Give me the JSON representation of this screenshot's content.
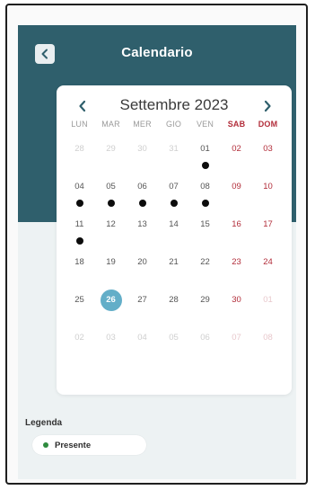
{
  "header": {
    "title": "Calendario",
    "background_color": "#2f5f6c",
    "back_icon": "chevron-left-icon"
  },
  "calendar": {
    "month_label": "Settembre 2023",
    "prev_icon": "chevron-left-icon",
    "next_icon": "chevron-right-icon",
    "weekdays": [
      {
        "label": "LUN",
        "weekend": false
      },
      {
        "label": "MAR",
        "weekend": false
      },
      {
        "label": "MER",
        "weekend": false
      },
      {
        "label": "GIO",
        "weekend": false
      },
      {
        "label": "VEN",
        "weekend": false
      },
      {
        "label": "SAB",
        "weekend": true
      },
      {
        "label": "DOM",
        "weekend": true
      }
    ],
    "weekend_color": "#b22d3a",
    "today_color": "#63aec8",
    "present_color": "#0c0c0c",
    "days": [
      {
        "label": "28",
        "muted": true,
        "weekend": false,
        "today": false,
        "present": false
      },
      {
        "label": "29",
        "muted": true,
        "weekend": false,
        "today": false,
        "present": false
      },
      {
        "label": "30",
        "muted": true,
        "weekend": false,
        "today": false,
        "present": false
      },
      {
        "label": "31",
        "muted": true,
        "weekend": false,
        "today": false,
        "present": false
      },
      {
        "label": "01",
        "muted": false,
        "weekend": false,
        "today": false,
        "present": true
      },
      {
        "label": "02",
        "muted": false,
        "weekend": true,
        "today": false,
        "present": false
      },
      {
        "label": "03",
        "muted": false,
        "weekend": true,
        "today": false,
        "present": false
      },
      {
        "label": "04",
        "muted": false,
        "weekend": false,
        "today": false,
        "present": true
      },
      {
        "label": "05",
        "muted": false,
        "weekend": false,
        "today": false,
        "present": true
      },
      {
        "label": "06",
        "muted": false,
        "weekend": false,
        "today": false,
        "present": true
      },
      {
        "label": "07",
        "muted": false,
        "weekend": false,
        "today": false,
        "present": true
      },
      {
        "label": "08",
        "muted": false,
        "weekend": false,
        "today": false,
        "present": true
      },
      {
        "label": "09",
        "muted": false,
        "weekend": true,
        "today": false,
        "present": false
      },
      {
        "label": "10",
        "muted": false,
        "weekend": true,
        "today": false,
        "present": false
      },
      {
        "label": "11",
        "muted": false,
        "weekend": false,
        "today": false,
        "present": true
      },
      {
        "label": "12",
        "muted": false,
        "weekend": false,
        "today": false,
        "present": false
      },
      {
        "label": "13",
        "muted": false,
        "weekend": false,
        "today": false,
        "present": false
      },
      {
        "label": "14",
        "muted": false,
        "weekend": false,
        "today": false,
        "present": false
      },
      {
        "label": "15",
        "muted": false,
        "weekend": false,
        "today": false,
        "present": false
      },
      {
        "label": "16",
        "muted": false,
        "weekend": true,
        "today": false,
        "present": false
      },
      {
        "label": "17",
        "muted": false,
        "weekend": true,
        "today": false,
        "present": false
      },
      {
        "label": "18",
        "muted": false,
        "weekend": false,
        "today": false,
        "present": false
      },
      {
        "label": "19",
        "muted": false,
        "weekend": false,
        "today": false,
        "present": false
      },
      {
        "label": "20",
        "muted": false,
        "weekend": false,
        "today": false,
        "present": false
      },
      {
        "label": "21",
        "muted": false,
        "weekend": false,
        "today": false,
        "present": false
      },
      {
        "label": "22",
        "muted": false,
        "weekend": false,
        "today": false,
        "present": false
      },
      {
        "label": "23",
        "muted": false,
        "weekend": true,
        "today": false,
        "present": false
      },
      {
        "label": "24",
        "muted": false,
        "weekend": true,
        "today": false,
        "present": false
      },
      {
        "label": "25",
        "muted": false,
        "weekend": false,
        "today": false,
        "present": false
      },
      {
        "label": "26",
        "muted": false,
        "weekend": false,
        "today": true,
        "present": false
      },
      {
        "label": "27",
        "muted": false,
        "weekend": false,
        "today": false,
        "present": false
      },
      {
        "label": "28",
        "muted": false,
        "weekend": false,
        "today": false,
        "present": false
      },
      {
        "label": "29",
        "muted": false,
        "weekend": false,
        "today": false,
        "present": false
      },
      {
        "label": "30",
        "muted": false,
        "weekend": true,
        "today": false,
        "present": false
      },
      {
        "label": "01",
        "muted": true,
        "weekend": true,
        "today": false,
        "present": false
      },
      {
        "label": "02",
        "muted": true,
        "weekend": false,
        "today": false,
        "present": false
      },
      {
        "label": "03",
        "muted": true,
        "weekend": false,
        "today": false,
        "present": false
      },
      {
        "label": "04",
        "muted": true,
        "weekend": false,
        "today": false,
        "present": false
      },
      {
        "label": "05",
        "muted": true,
        "weekend": false,
        "today": false,
        "present": false
      },
      {
        "label": "06",
        "muted": true,
        "weekend": false,
        "today": false,
        "present": false
      },
      {
        "label": "07",
        "muted": true,
        "weekend": true,
        "today": false,
        "present": false
      },
      {
        "label": "08",
        "muted": true,
        "weekend": true,
        "today": false,
        "present": false
      }
    ]
  },
  "legend": {
    "title": "Legenda",
    "items": [
      {
        "label": "Presente",
        "color": "#2e8b3e"
      }
    ]
  }
}
